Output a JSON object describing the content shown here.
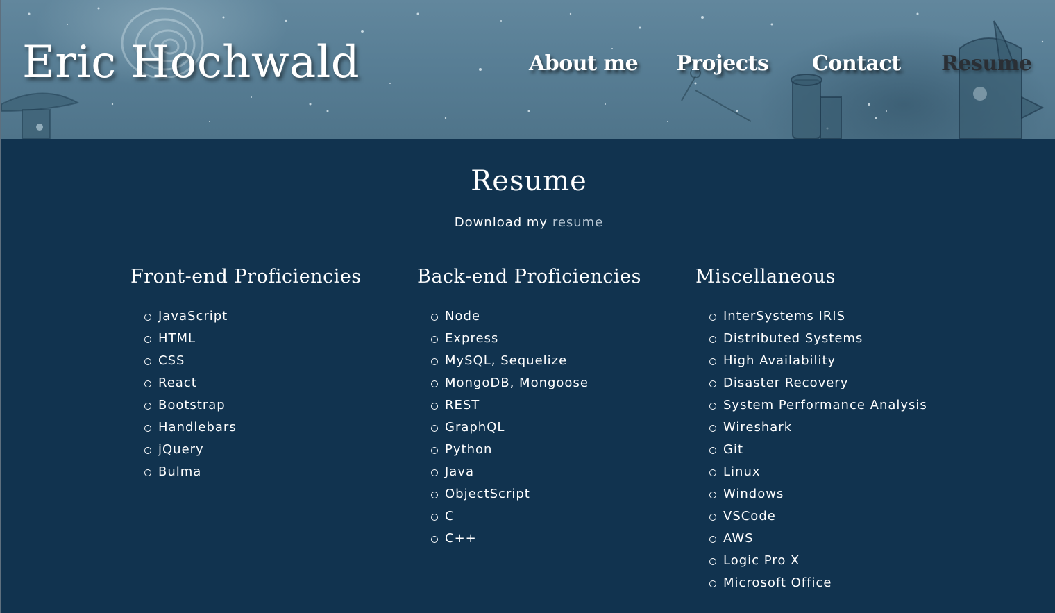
{
  "header": {
    "site_title": "Eric Hochwald",
    "nav": [
      {
        "label": "About me",
        "active": false
      },
      {
        "label": "Projects",
        "active": false
      },
      {
        "label": "Contact",
        "active": false
      },
      {
        "label": "Resume",
        "active": true
      }
    ]
  },
  "main": {
    "title": "Resume",
    "download_prefix": "Download my ",
    "download_link": "resume",
    "columns": [
      {
        "heading": "Front-end Proficiencies",
        "items": [
          "JavaScript",
          "HTML",
          "CSS",
          "React",
          "Bootstrap",
          "Handlebars",
          "jQuery",
          "Bulma"
        ]
      },
      {
        "heading": "Back-end Proficiencies",
        "items": [
          "Node",
          "Express",
          "MySQL, Sequelize",
          "MongoDB, Mongoose",
          "REST",
          "GraphQL",
          "Python",
          "Java",
          "ObjectScript",
          "C",
          "C++"
        ]
      },
      {
        "heading": "Miscellaneous",
        "items": [
          "InterSystems IRIS",
          "Distributed Systems",
          "High Availability",
          "Disaster Recovery",
          "System Performance Analysis",
          "Wireshark",
          "Git",
          "Linux",
          "Windows",
          "VSCode",
          "AWS",
          "Logic Pro X",
          "Microsoft Office"
        ]
      }
    ]
  },
  "colors": {
    "page_background": "#11334f",
    "header_background": "#5b8197",
    "link_muted": "#b7c6d3",
    "active_nav": "#2a2f35",
    "text": "#ffffff"
  }
}
